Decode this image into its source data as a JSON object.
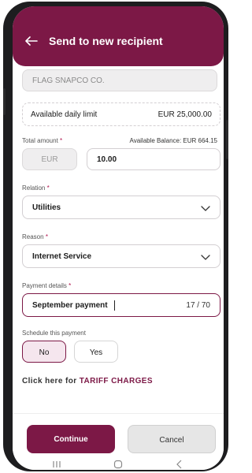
{
  "header": {
    "title": "Send to new recipient"
  },
  "company": {
    "name": "FLAG SNAPCO CO."
  },
  "daily_limit": {
    "label": "Available daily limit",
    "value": "EUR 25,000.00"
  },
  "amount": {
    "label": "Total amount",
    "required_mark": "*",
    "balance": "Available Balance: EUR 664.15",
    "currency": "EUR",
    "value": "10.00"
  },
  "relation": {
    "label": "Relation",
    "required_mark": "*",
    "value": "Utilities"
  },
  "reason": {
    "label": "Reason",
    "required_mark": "*",
    "value": "Internet Service"
  },
  "payment_details": {
    "label": "Payment details",
    "required_mark": "*",
    "value": "September payment",
    "counter": "17 / 70"
  },
  "schedule": {
    "label": "Schedule this payment",
    "no": "No",
    "yes": "Yes"
  },
  "tariff": {
    "prefix": "Click here for",
    "link": "TARIFF CHARGES"
  },
  "actions": {
    "continue": "Continue",
    "cancel": "Cancel"
  },
  "colors": {
    "brand": "#7c1846",
    "selected_bg": "#f5e6ee"
  }
}
